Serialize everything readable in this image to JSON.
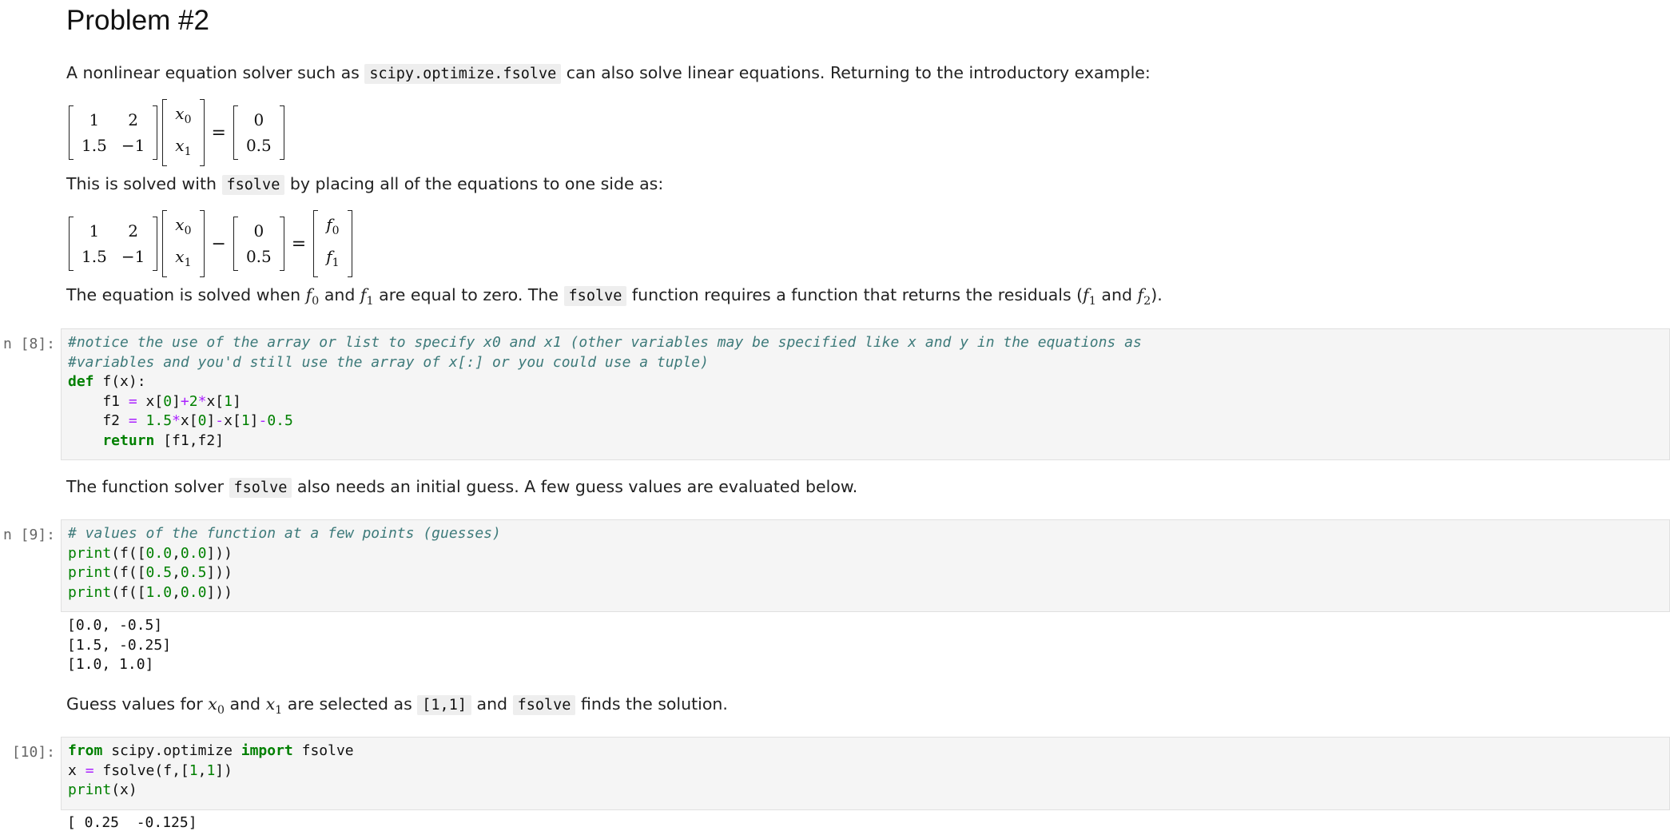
{
  "heading": "Problem #2",
  "para1": {
    "pre": "A nonlinear equation solver such as ",
    "code": "scipy.optimize.fsolve",
    "post": " can also solve linear equations. Returning to the introductory example:"
  },
  "eq1": {
    "A": [
      "1",
      "2",
      "1.5",
      "−1"
    ],
    "x": [
      "x",
      "0",
      "x",
      "1"
    ],
    "eq": "=",
    "b": [
      "0",
      "0.5"
    ]
  },
  "para2": {
    "pre": "This is solved with ",
    "code": "fsolve",
    "post": " by placing all of the equations to one side as:"
  },
  "eq2": {
    "A": [
      "1",
      "2",
      "1.5",
      "−1"
    ],
    "x": [
      "x",
      "0",
      "x",
      "1"
    ],
    "minus": "−",
    "b": [
      "0",
      "0.5"
    ],
    "eq": "=",
    "f": [
      "f",
      "0",
      "f",
      "1"
    ]
  },
  "para3": {
    "t1": "The equation is solved when ",
    "m1": "f",
    "m1s": "0",
    "t2": " and ",
    "m2": "f",
    "m2s": "1",
    "t3": " are equal to zero. The ",
    "code": "fsolve",
    "t4": " function requires a function that returns the residuals (",
    "m3": "f",
    "m3s": "1",
    "t5": " and ",
    "m4": "f",
    "m4s": "2",
    "t6": ")."
  },
  "cell8": {
    "prompt": "n [8]:",
    "l1": "#notice the use of the array or list to specify x0 and x1 (other variables may be specified like x and y in the equations as",
    "l2": "#variables and you'd still use the array of x[:] or you could use a tuple)",
    "l3a": "def",
    "l3b": " f(x):",
    "l4a": "    f1 ",
    "l4b": "=",
    "l4c": " x[",
    "l4d": "0",
    "l4e": "]",
    "l4f": "+",
    "l4g": "2",
    "l4h": "*",
    "l4i": "x[",
    "l4j": "1",
    "l4k": "]",
    "l5a": "    f2 ",
    "l5b": "=",
    "l5c": " ",
    "l5d": "1.5",
    "l5e": "*",
    "l5f": "x[",
    "l5g": "0",
    "l5h": "]",
    "l5i": "-",
    "l5j": "x[",
    "l5k": "1",
    "l5l": "]",
    "l5m": "-",
    "l5n": "0.5",
    "l6a": "    return",
    "l6b": " [f1,f2]"
  },
  "para4": {
    "pre": "The function solver ",
    "code": "fsolve",
    "post": " also needs an initial guess. A few guess values are evaluated below."
  },
  "cell9": {
    "prompt": "n [9]:",
    "l1": "# values of the function at a few points (guesses)",
    "lines": [
      {
        "a": "print",
        "b": "(f([",
        "c": "0.0",
        "d": ",",
        "e": "0.0",
        "f": "]))"
      },
      {
        "a": "print",
        "b": "(f([",
        "c": "0.5",
        "d": ",",
        "e": "0.5",
        "f": "]))"
      },
      {
        "a": "print",
        "b": "(f([",
        "c": "1.0",
        "d": ",",
        "e": "0.0",
        "f": "]))"
      }
    ],
    "output": [
      "[0.0, -0.5]",
      "[1.5, -0.25]",
      "[1.0, 1.0]"
    ]
  },
  "para5": {
    "t1": "Guess values for ",
    "m1": "x",
    "m1s": "0",
    "t2": " and ",
    "m2": "x",
    "m2s": "1",
    "t3": " are selected as ",
    "code1": "[1,1]",
    "t4": " and ",
    "code2": "fsolve",
    "t5": " finds the solution."
  },
  "cell10": {
    "prompt": "[10]:",
    "l1a": "from",
    "l1b": " scipy.optimize ",
    "l1c": "import",
    "l1d": " fsolve",
    "l2a": "x ",
    "l2b": "=",
    "l2c": " fsolve(f,[",
    "l2d": "1",
    "l2e": ",",
    "l2f": "1",
    "l2g": "])",
    "l3a": "print",
    "l3b": "(x)",
    "output": "[ 0.25  -0.125]"
  }
}
